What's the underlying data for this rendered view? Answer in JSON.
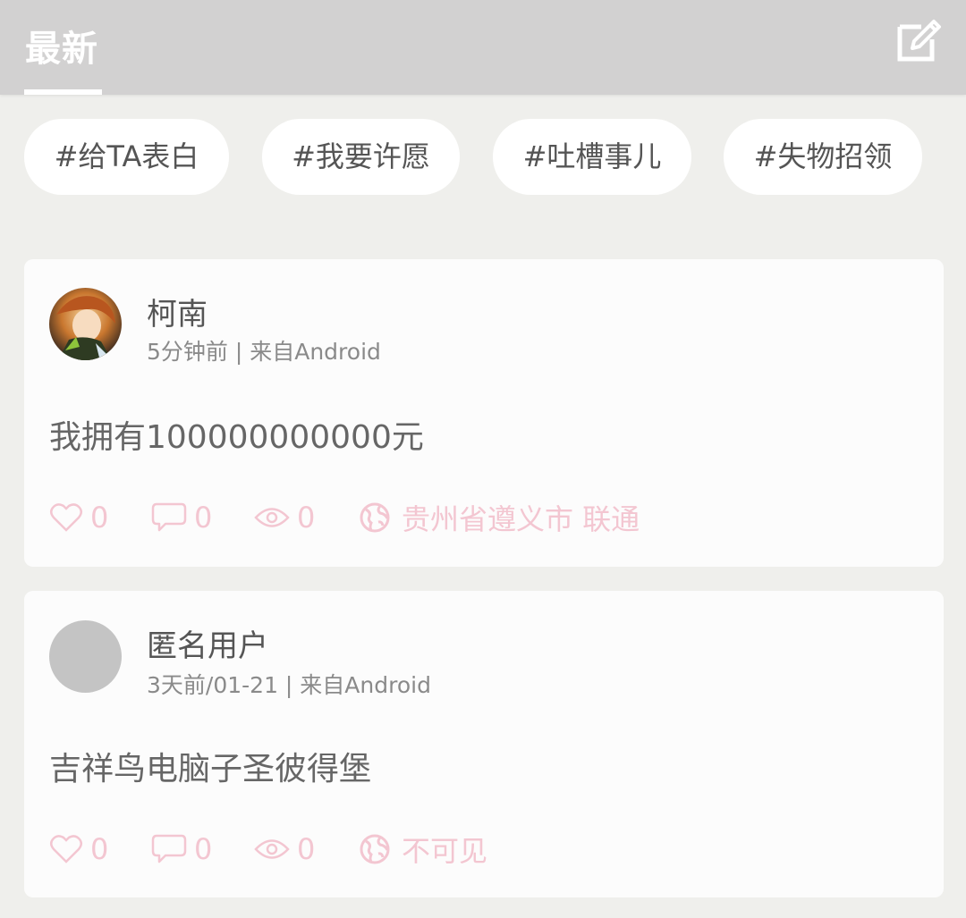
{
  "header": {
    "tab_label": "最新"
  },
  "tags": [
    "#给TA表白",
    "#我要许愿",
    "#吐槽事儿",
    "#失物招领"
  ],
  "posts": [
    {
      "username": "柯南",
      "meta": "5分钟前 | 来自Android",
      "content": "我拥有100000000000元",
      "likes": "0",
      "comments": "0",
      "views": "0",
      "location": "贵州省遵义市 联通"
    },
    {
      "username": "匿名用户",
      "meta": "3天前/01-21 | 来自Android",
      "content": "吉祥鸟电脑子圣彼得堡",
      "likes": "0",
      "comments": "0",
      "views": "0",
      "location": "不可见"
    }
  ],
  "colors": {
    "header_bg": "#d2d1d1",
    "page_bg": "#efefec",
    "action_pink": "#f3c6d1"
  }
}
